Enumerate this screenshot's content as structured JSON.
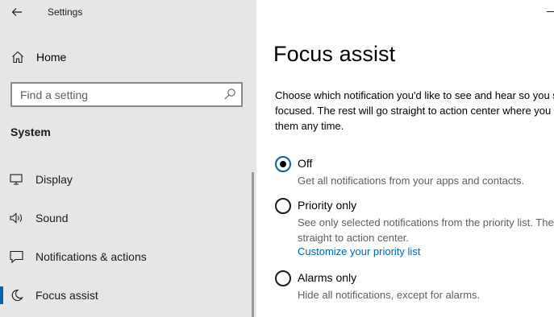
{
  "window": {
    "title": "Settings",
    "back_icon": "back-arrow-icon",
    "minimize_icon": "minimize-icon"
  },
  "sidebar": {
    "home": {
      "label": "Home",
      "icon": "home-icon"
    },
    "search": {
      "placeholder": "Find a setting",
      "value": "",
      "icon": "search-icon"
    },
    "section_title": "System",
    "items": [
      {
        "label": "Display",
        "icon": "display-icon",
        "selected": false
      },
      {
        "label": "Sound",
        "icon": "speaker-icon",
        "selected": false
      },
      {
        "label": "Notifications & actions",
        "icon": "notification-icon",
        "selected": false
      },
      {
        "label": "Focus assist",
        "icon": "moon-icon",
        "selected": true
      }
    ]
  },
  "main": {
    "title": "Focus assist",
    "description": "Choose which notification you'd like to see and hear so you stay focused. The rest will go straight to action center where you can see them any time.",
    "options": [
      {
        "label": "Off",
        "description": "Get all notifications from your apps and contacts.",
        "checked": true
      },
      {
        "label": "Priority only",
        "description": "See only selected notifications from the priority list. The rest will go straight to action center.",
        "link": "Customize your priority list",
        "checked": false
      },
      {
        "label": "Alarms only",
        "description": "Hide all notifications, except for alarms.",
        "checked": false
      }
    ]
  },
  "colors": {
    "accent": "#0063b1",
    "sidebar_bg": "#e6e6e6",
    "secondary_text": "#5e5e5e"
  }
}
